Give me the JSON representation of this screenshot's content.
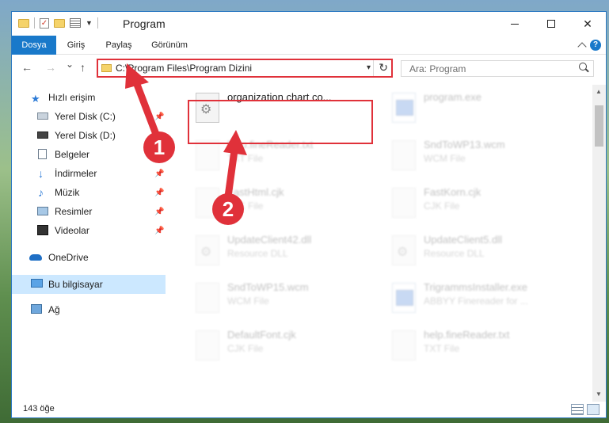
{
  "window": {
    "title": "Program",
    "minimize_glyph": "—",
    "close_glyph": "✕"
  },
  "ribbon": {
    "tabs": [
      "Dosya",
      "Giriş",
      "Paylaş",
      "Görünüm"
    ],
    "help": "?"
  },
  "nav": {
    "back": "←",
    "forward": "→",
    "recent": "⌄",
    "up": "↑",
    "address": "C:\\Program Files\\Program Dizini",
    "refresh": "↻",
    "search_placeholder": "Ara: Program"
  },
  "sidebar": {
    "items": [
      {
        "label": "Hızlı erişim",
        "icon": "star-icon"
      },
      {
        "label": "Yerel Disk (C:)",
        "icon": "drive-icon",
        "pinned": true
      },
      {
        "label": "Yerel Disk (D:)",
        "icon": "drive-icon"
      },
      {
        "label": "Belgeler",
        "icon": "documents-icon"
      },
      {
        "label": "İndirmeler",
        "icon": "download-icon",
        "pinned": true
      },
      {
        "label": "Müzik",
        "icon": "music-icon",
        "pinned": true
      },
      {
        "label": "Resimler",
        "icon": "pictures-icon",
        "pinned": true
      },
      {
        "label": "Videolar",
        "icon": "videos-icon",
        "pinned": true
      },
      {
        "label": "OneDrive",
        "icon": "cloud-icon"
      },
      {
        "label": "Bu bilgisayar",
        "icon": "computer-icon",
        "selected": true
      },
      {
        "label": "Ağ",
        "icon": "network-icon"
      }
    ],
    "pin_glyph": "📌"
  },
  "files": [
    {
      "name": "organization chart co...",
      "type": "",
      "icon": "settings-file-icon",
      "highlighted": true
    },
    {
      "name": "program.exe",
      "type": "",
      "icon": "exe-icon"
    },
    {
      "name": "help.fineReader.txt",
      "type": "TXT File",
      "icon": "text-file-icon"
    },
    {
      "name": "SndToWP13.wcm",
      "type": "WCM File",
      "icon": "blank-file-icon"
    },
    {
      "name": "FastHtml.cjk",
      "type": "CJK File",
      "icon": "blank-file-icon"
    },
    {
      "name": "FastKorn.cjk",
      "type": "CJK File",
      "icon": "blank-file-icon"
    },
    {
      "name": "UpdateClient42.dll",
      "type": "Resource DLL",
      "icon": "settings-file-icon"
    },
    {
      "name": "UpdateClient5.dll",
      "type": "Resource DLL",
      "icon": "settings-file-icon"
    },
    {
      "name": "SndToWP15.wcm",
      "type": "WCM File",
      "icon": "blank-file-icon"
    },
    {
      "name": "TrigrammsInstaller.exe",
      "type": "ABBYY Finereader for ...",
      "icon": "exe-icon"
    },
    {
      "name": "DefaultFont.cjk",
      "type": "CJK File",
      "icon": "blank-file-icon"
    },
    {
      "name": "help.fineReader.txt",
      "type": "TXT File",
      "icon": "text-file-icon"
    }
  ],
  "annotations": {
    "step1": "1",
    "step2": "2",
    "color": "#e0313a"
  },
  "status": {
    "count": "143 öğe"
  },
  "colors": {
    "accent": "#1979ca",
    "highlight": "#e0313a",
    "selected_bg": "#cce8ff"
  }
}
